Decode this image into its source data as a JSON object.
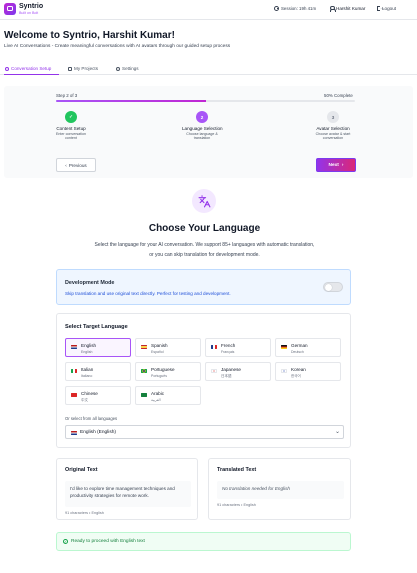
{
  "brand": {
    "name": "Syntrio",
    "tagline": "Built on Bolt"
  },
  "header": {
    "session": "Session: 19h 41m",
    "user": "Harshit Kumar",
    "logout": "Logout"
  },
  "welcome": {
    "title": "Welcome to Syntrio, Harshit Kumar!",
    "subtitle": "Live AI Conversations - Create meaningful conversations with AI avatars through our guided setup process"
  },
  "tabs": [
    {
      "label": "Conversation Setup",
      "icon": "chat-icon",
      "active": true
    },
    {
      "label": "My Projects",
      "icon": "folder-icon"
    },
    {
      "label": "Settings",
      "icon": "gear-icon"
    }
  ],
  "stepper": {
    "step_text": "Step 2 of 3",
    "complete_text": "50% Complete",
    "progress": 0.5,
    "steps": [
      {
        "marker": "✓",
        "title": "Content Setup",
        "desc": "Enter conversation content",
        "state": "done",
        "color": "#22c55e"
      },
      {
        "marker": "2",
        "title": "Language Selection",
        "desc": "Choose language & translation",
        "state": "current",
        "color": "#a855f7"
      },
      {
        "marker": "3",
        "title": "Avatar Selection",
        "desc": "Choose avatar & start conversation",
        "state": "pending",
        "color": "#e5e7eb"
      }
    ],
    "prev_label": "Previous",
    "next_label": "Next"
  },
  "hero": {
    "icon": "translate-icon",
    "title": "Choose Your Language",
    "text": "Select the language for your AI conversation. We support 85+ languages with automatic translation, or you can skip translation for development mode."
  },
  "dev_mode": {
    "title": "Development Mode",
    "desc": "Skip translation and use original text directly. Perfect for testing and development.",
    "enabled": false
  },
  "language_select": {
    "title": "Select Target Language",
    "languages": [
      {
        "name": "English",
        "native": "English",
        "flag": "flag-us",
        "selected": true
      },
      {
        "name": "Spanish",
        "native": "Español",
        "flag": "flag-es"
      },
      {
        "name": "French",
        "native": "Français",
        "flag": "flag-fr"
      },
      {
        "name": "German",
        "native": "Deutsch",
        "flag": "flag-de"
      },
      {
        "name": "Italian",
        "native": "Italiano",
        "flag": "flag-it"
      },
      {
        "name": "Portuguese",
        "native": "Português",
        "flag": "flag-br"
      },
      {
        "name": "Japanese",
        "native": "日本語",
        "flag": "flag-jp"
      },
      {
        "name": "Korean",
        "native": "한국어",
        "flag": "flag-kr"
      },
      {
        "name": "Chinese",
        "native": "中文",
        "flag": "flag-cn"
      },
      {
        "name": "Arabic",
        "native": "العربية",
        "flag": "flag-sa"
      }
    ],
    "or_label": "Or select from all languages",
    "dropdown_value": "English (English)"
  },
  "original": {
    "title": "Original Text",
    "text": "I'd like to explore time management techniques and productivity strategies for remote work.",
    "count": "91 characters • English"
  },
  "translated": {
    "title": "Translated Text",
    "text": "No translation needed for English",
    "count": "91 characters • English"
  },
  "ready": "Ready to proceed with English text",
  "colors": {
    "accent": "#9333ea",
    "accent_pink": "#db2777",
    "success": "#16a34a",
    "info": "#1d4ed8"
  }
}
